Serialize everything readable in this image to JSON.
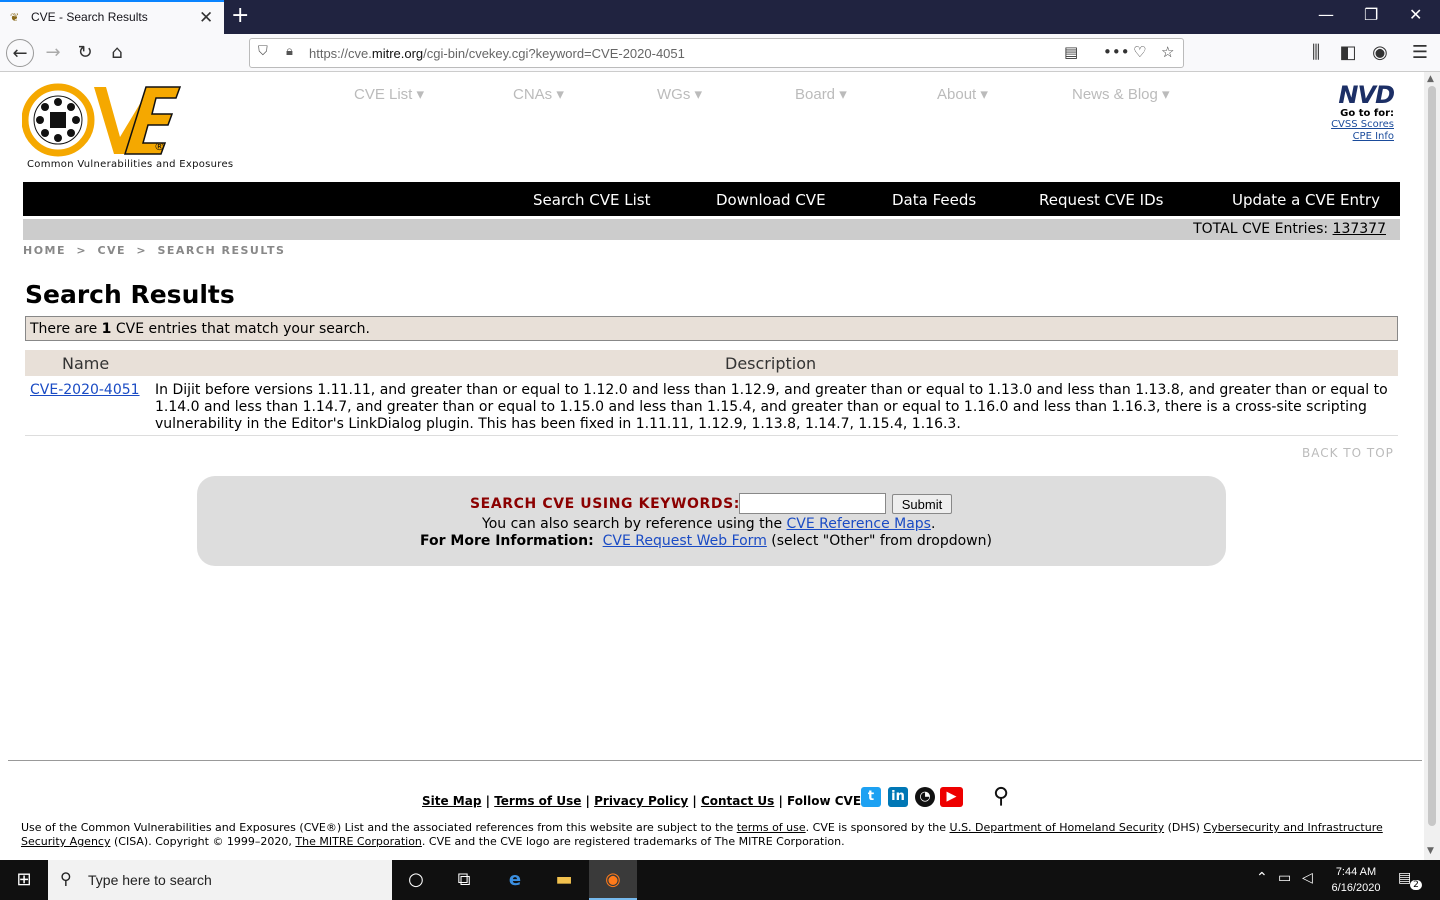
{
  "browser": {
    "tab_title": "CVE - Search Results",
    "url_prefix": "https://cve.",
    "url_domain": "mitre.org",
    "url_path": "/cgi-bin/cvekey.cgi?keyword=CVE-2020-4051"
  },
  "site": {
    "logo_text": "CVE",
    "logo_sub": "Common Vulnerabilities and Exposures",
    "top_nav": [
      "CVE List ▾",
      "CNAs ▾",
      "WGs ▾",
      "Board ▾",
      "About ▾",
      "News & Blog ▾"
    ],
    "nvd": {
      "logo": "NVD",
      "goto": "Go to for:",
      "links": [
        "CVSS Scores",
        "CPE Info"
      ]
    },
    "black_bar": [
      "Search CVE List",
      "Download CVE",
      "Data Feeds",
      "Request CVE IDs",
      "Update a CVE Entry"
    ],
    "total_label": "TOTAL CVE Entries:",
    "total_value": "137377",
    "breadcrumb": [
      "HOME",
      ">",
      "CVE",
      ">",
      "SEARCH RESULTS"
    ]
  },
  "results": {
    "title": "Search Results",
    "match_pre": "There are ",
    "match_count": "1",
    "match_post": " CVE entries that match your search.",
    "col_name": "Name",
    "col_desc": "Description",
    "rows": [
      {
        "id": "CVE-2020-4051",
        "description": "In Dijit before versions 1.11.11, and greater than or equal to 1.12.0 and less than 1.12.9, and greater than or equal to 1.13.0 and less than 1.13.8, and greater than or equal to 1.14.0 and less than 1.14.7, and greater than or equal to 1.15.0 and less than 1.15.4, and greater than or equal to 1.16.0 and less than 1.16.3, there is a cross-site scripting vulnerability in the Editor's LinkDialog plugin. This has been fixed in 1.11.11, 1.12.9, 1.13.8, 1.14.7, 1.15.4, 1.16.3."
      }
    ],
    "back_to_top": "BACK TO TOP"
  },
  "search_panel": {
    "label": "SEARCH CVE USING KEYWORDS:",
    "input_value": "",
    "submit": "Submit",
    "also_pre": "You can also search by reference using the ",
    "also_link": "CVE Reference Maps",
    "also_post": ".",
    "more_label": "For More Information:",
    "more_link": "CVE Request Web Form",
    "more_post": " (select \"Other\" from dropdown)"
  },
  "footer": {
    "links": [
      "Site Map",
      "Terms of Use",
      "Privacy Policy",
      "Contact Us"
    ],
    "sep": "|",
    "follow": "Follow CVE",
    "legal_1": "Use of the Common Vulnerabilities and Exposures (CVE®) List and the associated references from this website are subject to the ",
    "legal_terms": "terms of use",
    "legal_2": ". CVE is sponsored by the ",
    "legal_dhs": "U.S. Department of Homeland Security",
    "legal_3": " (DHS) ",
    "legal_cisa": "Cybersecurity and Infrastructure Security Agency",
    "legal_4": " (CISA). Copyright © 1999–2020, ",
    "legal_mitre": "The MITRE Corporation",
    "legal_5": ". CVE and the CVE logo are registered trademarks of The MITRE Corporation."
  },
  "taskbar": {
    "search_placeholder": "Type here to search",
    "time": "7:44 AM",
    "date": "6/16/2020",
    "notif_count": "2"
  },
  "colors": {
    "logo_orange": "#f5a800",
    "nav_black": "#000000",
    "search_label": "#8b0000",
    "link_blue": "#1a4bc4"
  }
}
